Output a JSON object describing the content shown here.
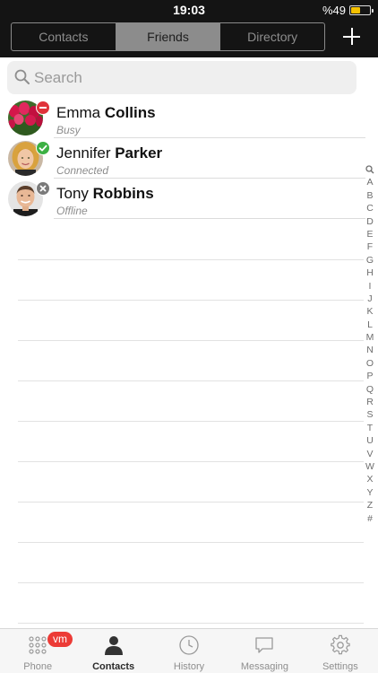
{
  "status_bar": {
    "time": "19:03",
    "battery_percent": "%49",
    "battery_level": 0.49,
    "battery_color": "#f5c100"
  },
  "segments": {
    "items": [
      "Contacts",
      "Friends",
      "Directory"
    ],
    "selected": "Friends"
  },
  "toolbar": {
    "add_icon": "plus-icon"
  },
  "search": {
    "placeholder": "Search",
    "value": ""
  },
  "contacts": [
    {
      "first": "Emma",
      "last": "Collins",
      "status": "Busy",
      "presence": "busy",
      "presence_color": "#e0323a",
      "avatar": "tulips-photo"
    },
    {
      "first": "Jennifer",
      "last": "Parker",
      "status": "Connected",
      "presence": "connected",
      "presence_color": "#3cb043",
      "avatar": "woman-portrait"
    },
    {
      "first": "Tony",
      "last": "Robbins",
      "status": "Offline",
      "presence": "offline",
      "presence_color": "#7a7a7a",
      "avatar": "man-portrait"
    }
  ],
  "index": [
    "A",
    "B",
    "C",
    "D",
    "E",
    "F",
    "G",
    "H",
    "I",
    "J",
    "K",
    "L",
    "M",
    "N",
    "O",
    "P",
    "Q",
    "R",
    "S",
    "T",
    "U",
    "V",
    "W",
    "X",
    "Y",
    "Z",
    "#"
  ],
  "tabs": [
    {
      "label": "Phone",
      "icon": "dialpad-icon"
    },
    {
      "label": "Contacts",
      "icon": "person-icon"
    },
    {
      "label": "History",
      "icon": "clock-icon"
    },
    {
      "label": "Messaging",
      "icon": "chat-bubble-icon"
    },
    {
      "label": "Settings",
      "icon": "gear-icon"
    }
  ],
  "active_tab": "Contacts",
  "phone_badge": "vm"
}
